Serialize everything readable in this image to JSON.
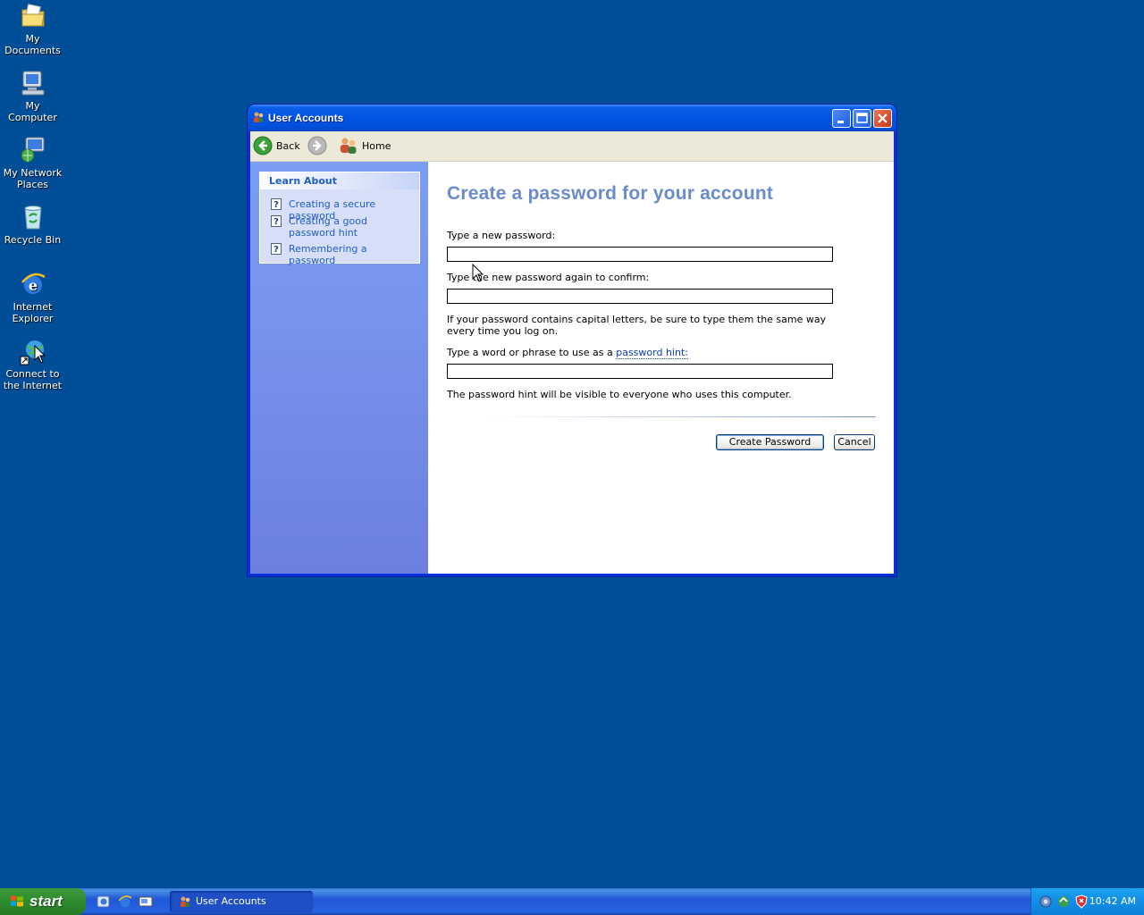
{
  "desktop": {
    "icons": [
      {
        "label": "My Documents",
        "icon": "my-documents-icon"
      },
      {
        "label": "My Computer",
        "icon": "my-computer-icon"
      },
      {
        "label": "My Network Places",
        "icon": "network-places-icon"
      },
      {
        "label": "Recycle Bin",
        "icon": "recycle-bin-icon"
      },
      {
        "label": "Internet Explorer",
        "icon": "internet-explorer-icon"
      },
      {
        "label": "Connect to the Internet",
        "icon": "connect-internet-icon"
      }
    ]
  },
  "window": {
    "title": "User Accounts",
    "toolbar": {
      "back_label": "Back",
      "home_label": "Home"
    },
    "learn_about": {
      "heading": "Learn About",
      "items": [
        {
          "label": "Creating a secure password"
        },
        {
          "label": "Creating a good password hint"
        },
        {
          "label": "Remembering a password"
        }
      ]
    },
    "main": {
      "heading": "Create a password for your account",
      "new_password_label": "Type a new password:",
      "new_password_value": "",
      "confirm_label": "Type the new password again to confirm:",
      "confirm_value": "",
      "caps_note": "If your password contains capital letters, be sure to type them the same way every time you log on.",
      "hint_label_prefix": "Type a word or phrase to use as a",
      "hint_link": "password hint:",
      "hint_value": "",
      "hint_note": "The password hint will be visible to everyone who uses this computer.",
      "create_button": "Create Password",
      "cancel_button": "Cancel"
    }
  },
  "taskbar": {
    "start_label": "start",
    "task_items": [
      {
        "label": "User Accounts"
      }
    ],
    "clock": "10:42 AM"
  },
  "colors": {
    "desktop": "#004E98",
    "heading": "#6B8BCC",
    "link": "#0B3EAE",
    "titlebar": "#0054E3"
  }
}
